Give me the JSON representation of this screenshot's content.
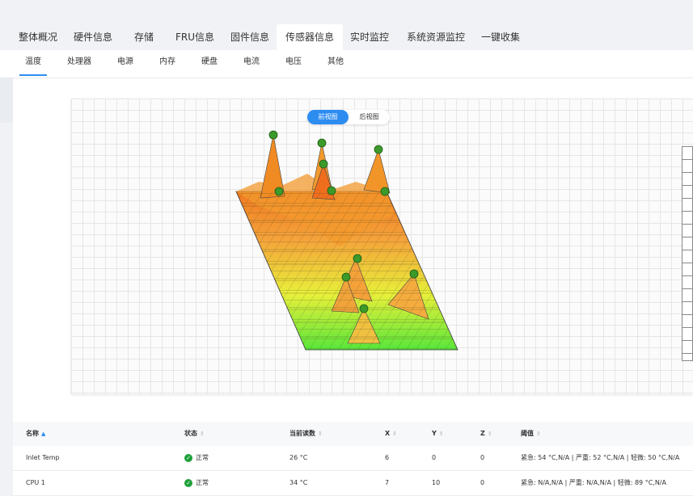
{
  "main_tabs": [
    "整体概况",
    "硬件信息",
    "存储",
    "FRU信息",
    "固件信息",
    "传感器信息",
    "实时监控",
    "系统资源监控",
    "一键收集"
  ],
  "main_tab_active": "传感器信息",
  "sub_tabs": [
    "温度",
    "处理器",
    "电源",
    "内存",
    "硬盘",
    "电流",
    "电压",
    "其他"
  ],
  "sub_tab_active": "温度",
  "view_toggle": {
    "front": "前视图",
    "back": "后视图",
    "active": "前视图"
  },
  "colors": {
    "accent": "#2d8cf0",
    "status_ok": "#1fa03a"
  },
  "table": {
    "headers": {
      "name": "名称",
      "status": "状态",
      "reading": "当前读数",
      "x": "X",
      "y": "Y",
      "z": "Z",
      "threshold": "阈值"
    },
    "sort_column": "名称",
    "rows": [
      {
        "name": "Inlet Temp",
        "status": "正常",
        "reading": "26 °C",
        "x": "6",
        "y": "0",
        "z": "0",
        "threshold": "紧急: 54 °C,N/A | 严重: 52 °C,N/A | 轻微: 50 °C,N/A"
      },
      {
        "name": "CPU 1",
        "status": "正常",
        "reading": "34 °C",
        "x": "7",
        "y": "10",
        "z": "0",
        "threshold": "紧急: N/A,N/A | 严重: N/A,N/A | 轻微: 89 °C,N/A"
      }
    ]
  },
  "icons": {
    "status_ok": "check-circle-icon",
    "sort_asc": "sort-asc-icon",
    "sort": "sort-icon"
  }
}
